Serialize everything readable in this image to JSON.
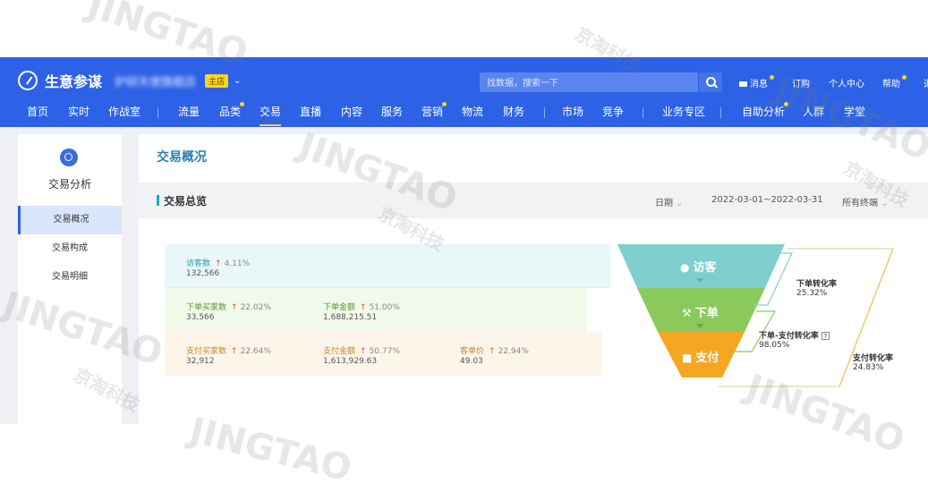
{
  "app": {
    "name": "生意参谋",
    "shop_name": "护研天使旗舰店",
    "shop_tag": "主店"
  },
  "search": {
    "placeholder": "找数据，搜索一下"
  },
  "utilities": {
    "messages": "消息",
    "orders": "订购",
    "profile": "个人中心",
    "help": "帮助",
    "overflow": "退"
  },
  "nav": {
    "items": [
      "首页",
      "实时",
      "作战室",
      "流量",
      "品类",
      "交易",
      "直播",
      "内容",
      "服务",
      "营销",
      "物流",
      "财务",
      "市场",
      "竞争",
      "业务专区",
      "自助分析",
      "人群",
      "学堂"
    ],
    "active": "交易"
  },
  "sidebar": {
    "title": "交易分析",
    "items": [
      "交易概况",
      "交易构成",
      "交易明细"
    ],
    "active": "交易概况"
  },
  "main": {
    "title": "交易概况",
    "section_title": "交易总览",
    "filters": {
      "date_label": "日期",
      "date_range": "2022-03-01~2022-03-31",
      "terminal": "所有终端"
    }
  },
  "metrics": {
    "visitors": {
      "label": "访客数",
      "change": "4.11%",
      "value": "132,566"
    },
    "order_buyers": {
      "label": "下单买家数",
      "change": "22.02%",
      "value": "33,566"
    },
    "order_amount": {
      "label": "下单金额",
      "change": "51.00%",
      "value": "1,688,215.51"
    },
    "pay_buyers": {
      "label": "支付买家数",
      "change": "22.64%",
      "value": "32,912"
    },
    "pay_amount": {
      "label": "支付金额",
      "change": "50.77%",
      "value": "1,613,929.63"
    },
    "unit_price": {
      "label": "客单价",
      "change": "22.94%",
      "value": "49.03"
    }
  },
  "funnel": {
    "stages": [
      "访客",
      "下单",
      "支付"
    ],
    "colors": {
      "visit": "#7fcfcf",
      "order": "#8cc95c",
      "pay": "#f5a623",
      "visit_band": "#eaf7f8",
      "order_band": "#f1f9ea",
      "pay_band": "#fdf5ea"
    },
    "rates": {
      "order_rate": {
        "label": "下单转化率",
        "value": "25.32%"
      },
      "order_pay_rate": {
        "label": "下单-支付转化率",
        "value": "98.05%"
      },
      "pay_rate": {
        "label": "支付转化率",
        "value": "24.83%"
      }
    }
  },
  "watermark": {
    "latin": "JINGTAO",
    "chinese": "京淘科技"
  },
  "colors": {
    "brand_blue": "#2d62e6",
    "accent_yellow": "#f9d423",
    "title_teal": "#2c7fb5",
    "up_red": "#e8543f"
  }
}
